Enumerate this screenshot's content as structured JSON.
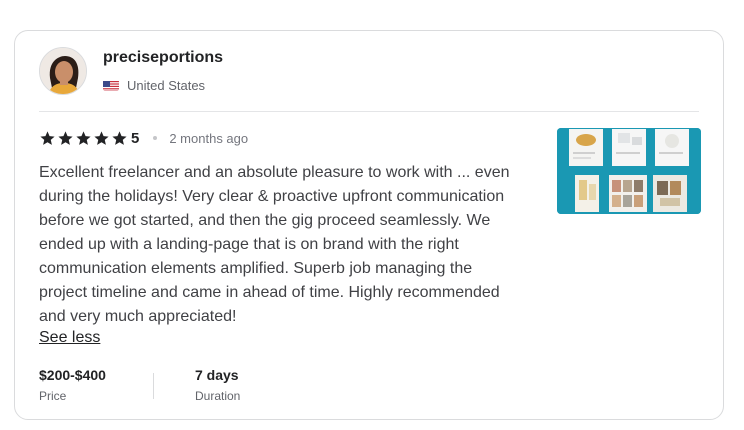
{
  "reviewer": {
    "username": "preciseportions",
    "country": "United States"
  },
  "review": {
    "rating": "5",
    "time_ago": "2 months ago",
    "stars_filled": 5,
    "text": "Excellent freelancer and an absolute pleasure to work with ... even during the holidays! Very clear & proactive upfront communication before we got started, and then the gig proceed seamlessly. We ended up with a landing-page that is on brand with the right communication elements amplified. Superb job managing the project timeline and came in ahead of time. Highly recommended and very much appreciated!",
    "toggle_label": "See less"
  },
  "meta": {
    "price_value": "$200-$400",
    "price_label": "Price",
    "duration_value": "7 days",
    "duration_label": "Duration"
  },
  "colors": {
    "text_primary": "#222325",
    "text_secondary": "#62646a",
    "border": "#dadbdd",
    "thumbnail_bg": "#1a98b3"
  },
  "icons": {
    "star": "star-icon",
    "flag": "us-flag-icon"
  }
}
